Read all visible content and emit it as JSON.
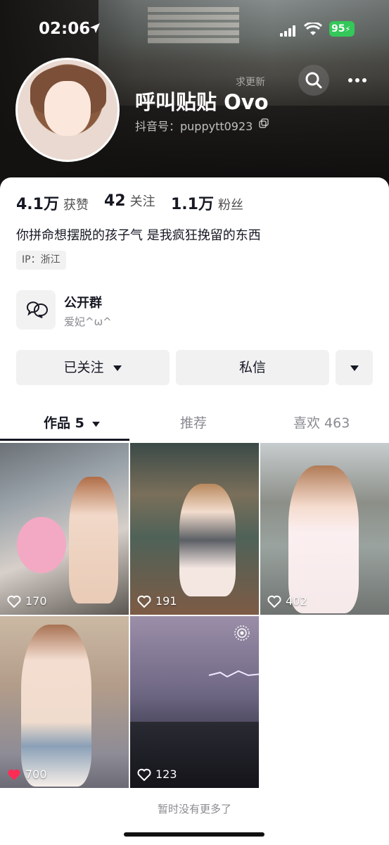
{
  "status_bar": {
    "time": "02:06",
    "battery": "95"
  },
  "header": {
    "ask_update": "求更新"
  },
  "profile": {
    "nickname": "呼叫贴贴 Ovo",
    "douyin_id": "抖音号：puppytt0923",
    "bio": "你拼命想摆脱的孩子气 是我疯狂挽留的东西",
    "ip": "IP：浙江"
  },
  "stats": [
    {
      "value": "4.1万",
      "label": "获赞"
    },
    {
      "value": "42",
      "label": "关注"
    },
    {
      "value": "1.1万",
      "label": "粉丝"
    }
  ],
  "group": {
    "title": "公开群",
    "subtitle": "爱妃^ω^"
  },
  "actions": {
    "follow_label": "已关注",
    "message_label": "私信"
  },
  "tabs": [
    {
      "label": "作品 5"
    },
    {
      "label": "推荐"
    },
    {
      "label": "喜欢 463"
    }
  ],
  "videos": [
    {
      "likes": "170",
      "liked": false
    },
    {
      "likes": "191",
      "liked": false
    },
    {
      "likes": "402",
      "liked": false
    },
    {
      "likes": "700",
      "liked": true
    },
    {
      "likes": "123",
      "liked": false
    }
  ],
  "footer": {
    "no_more": "暂时没有更多了"
  },
  "colors": {
    "liked_heart": "#fe2c55",
    "battery": "#34c759"
  }
}
